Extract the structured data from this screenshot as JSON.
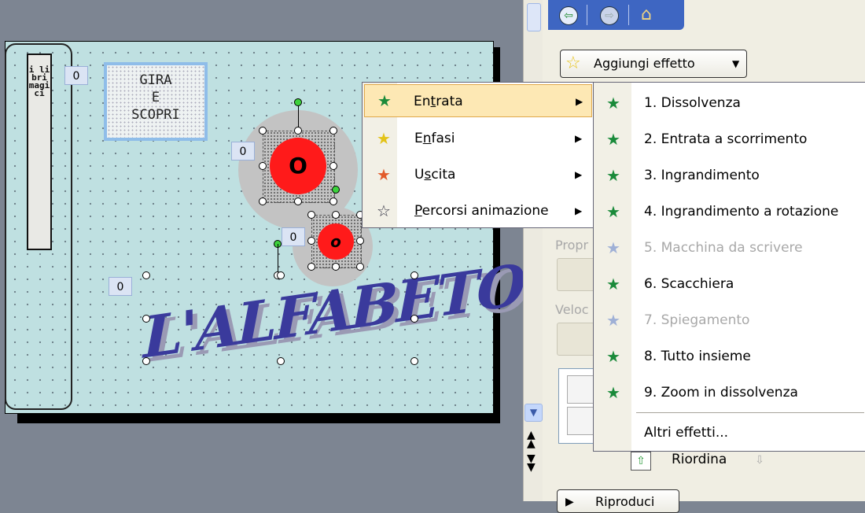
{
  "slide": {
    "vertical_title": "i libri magici",
    "gira_box": [
      "GIRA",
      "E",
      "SCOPRI"
    ],
    "order_badges": [
      "0",
      "0",
      "0",
      "0"
    ],
    "circle_big_label": "O",
    "circle_small_label": "o",
    "alfabeto_text": "L'ALFABETO"
  },
  "task_pane": {
    "add_effect_label": "Aggiungi effetto",
    "property_label": "Propr",
    "speed_label": "Veloc",
    "reorder_label": "Riordina",
    "play_label": "Riproduci"
  },
  "menu_main": {
    "items": [
      {
        "label": "Entrata",
        "mnemonic": "t",
        "icon": "star-green-entrance-icon",
        "highlighted": true
      },
      {
        "label": "Enfasi",
        "mnemonic": "n",
        "icon": "star-yellow-emphasis-icon"
      },
      {
        "label": "Uscita",
        "mnemonic": "s",
        "icon": "star-red-exit-icon"
      },
      {
        "label": "Percorsi animazione",
        "mnemonic": "P",
        "icon": "star-outline-path-icon"
      }
    ]
  },
  "submenu_entrata": {
    "items": [
      {
        "label": "1. Dissolvenza",
        "enabled": true
      },
      {
        "label": "2. Entrata a scorrimento",
        "enabled": true
      },
      {
        "label": "3. Ingrandimento",
        "enabled": true
      },
      {
        "label": "4. Ingrandimento a rotazione",
        "enabled": true
      },
      {
        "label": "5. Macchina da scrivere",
        "enabled": false
      },
      {
        "label": "6. Scacchiera",
        "enabled": true
      },
      {
        "label": "7. Spiegamento",
        "enabled": false
      },
      {
        "label": "8. Tutto insieme",
        "enabled": true
      },
      {
        "label": "9. Zoom in dissolvenza",
        "enabled": true
      }
    ],
    "more_effects": "Altri effetti..."
  },
  "colors": {
    "menu_highlight": "#fde8b4",
    "task_pane_header": "#3e66c2",
    "star_green": "#1a8a3a",
    "slide_bg": "#bfe0e1"
  }
}
